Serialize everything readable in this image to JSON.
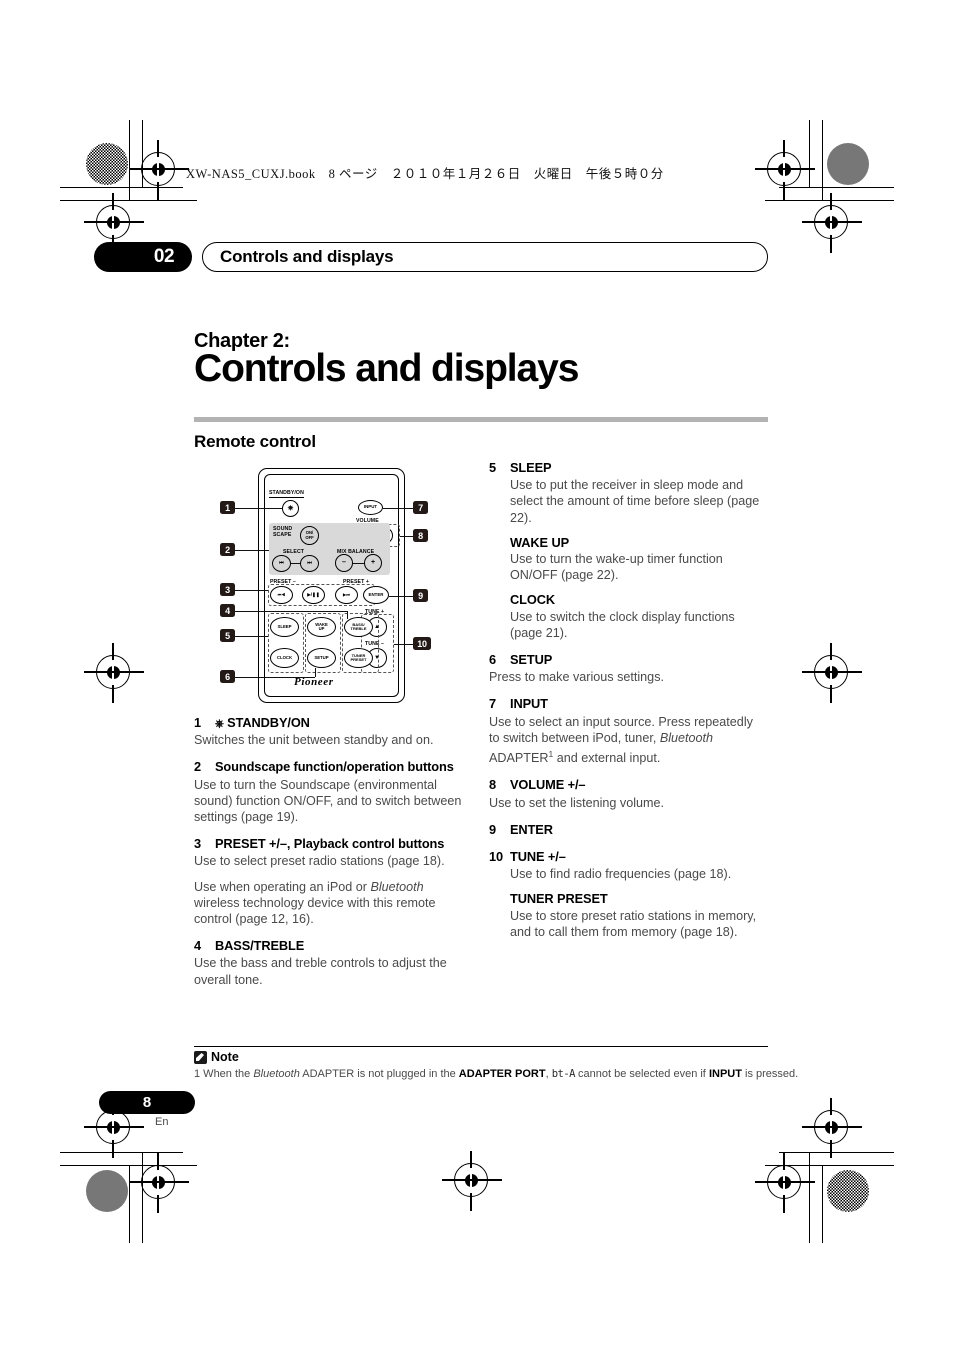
{
  "header": {
    "file_line": "XW-NAS5_CUXJ.book　8 ページ　２０１０年１月２６日　火曜日　午後５時０分",
    "chapter_number": "02",
    "running_title": "Controls and displays"
  },
  "chapter": {
    "label": "Chapter 2:",
    "title": "Controls and displays"
  },
  "section": {
    "title": "Remote control"
  },
  "left_column": [
    {
      "index": "1",
      "heading": "STANDBY/ON",
      "has_power_icon": true,
      "body": [
        "Switches the unit between standby and on."
      ]
    },
    {
      "index": "2",
      "heading": "Soundscape function/operation buttons",
      "body": [
        "Use to turn the Soundscape (environmental sound) function ON/OFF, and to switch between settings (page 19)."
      ]
    },
    {
      "index": "3",
      "heading": "PRESET +/–, Playback control buttons",
      "body": [
        "Use to select preset radio stations (page 18)."
      ],
      "body2_pre": "Use when operating an iPod or ",
      "body2_ital": "Bluetooth",
      "body2_post": " wireless technology device with this remote control (page 12, 16)."
    },
    {
      "index": "4",
      "heading": "BASS/TREBLE",
      "body": [
        "Use the bass and treble controls to adjust the overall tone."
      ]
    }
  ],
  "right_column": [
    {
      "index": "5",
      "heading": "SLEEP",
      "body": "Use to put the receiver in sleep mode and select the amount of time before sleep (page 22).",
      "subs": [
        {
          "heading": "WAKE UP",
          "body": "Use to turn the wake-up timer function ON/OFF (page 22)."
        },
        {
          "heading": "CLOCK",
          "body": "Use to switch the clock display functions (page 21)."
        }
      ]
    },
    {
      "index": "6",
      "heading": "SETUP",
      "body_flush": "Press to make various settings."
    },
    {
      "index": "7",
      "heading": "INPUT",
      "body_pre": "Use to select an input source. Press repeatedly to switch between iPod, tuner, ",
      "body_ital": "Bluetooth",
      "body_post": " ADAPTER",
      "body_sup": "1",
      "body_tail": " and external input."
    },
    {
      "index": "8",
      "heading": "VOLUME +/–",
      "body_flush": "Use to set the listening volume."
    },
    {
      "index": "9",
      "heading": "ENTER"
    },
    {
      "index": "10",
      "heading": "TUNE +/–",
      "body": "Use to find radio frequencies (page 18).",
      "subs": [
        {
          "heading": "TUNER PRESET",
          "body": "Use to store preset ratio stations in memory, and to call them from memory (page 18)."
        }
      ]
    }
  ],
  "note": {
    "label": "Note",
    "number": "1",
    "text_a": " When the ",
    "text_ital": "Bluetooth",
    "text_b": " ADAPTER is not plugged in the ",
    "text_bold1": "ADAPTER PORT",
    "text_c": ", ",
    "lcd": "bt-A",
    "text_d": " cannot be selected even if ",
    "text_bold2": "INPUT",
    "text_e": " is pressed."
  },
  "footer": {
    "page": "8",
    "lang": "En"
  },
  "remote": {
    "labels": {
      "standby_on": "STANDBY/ON",
      "input": "INPUT",
      "volume": "VOLUME",
      "sound_scape": "SOUND\nSCAPE",
      "on_off": "ON/\nOFF",
      "select": "SELECT",
      "mix_balance": "MIX  BALANCE",
      "preset_minus": "PRESET –",
      "preset_plus": "PRESET +",
      "enter": "ENTER",
      "tune_plus": "TUNE +",
      "tune_minus": "TUNE –",
      "sleep": "SLEEP",
      "wake_up": "WAKE\nUP",
      "bass_treble": "BASS/\nTREBLE",
      "clock": "CLOCK",
      "setup": "SETUP",
      "tuner_preset": "TUNER\nPRESET",
      "brand": "Pioneer",
      "minus": "–",
      "plus": "+",
      "prev": "⏮",
      "next": "⏭",
      "rew": "⏮◀◀",
      "play_pause": "▶/Ⅱ",
      "ff": "▶▶⏭",
      "up": "▲",
      "down": "▼"
    },
    "callouts": [
      "1",
      "2",
      "3",
      "4",
      "5",
      "6",
      "7",
      "8",
      "9",
      "10"
    ]
  }
}
